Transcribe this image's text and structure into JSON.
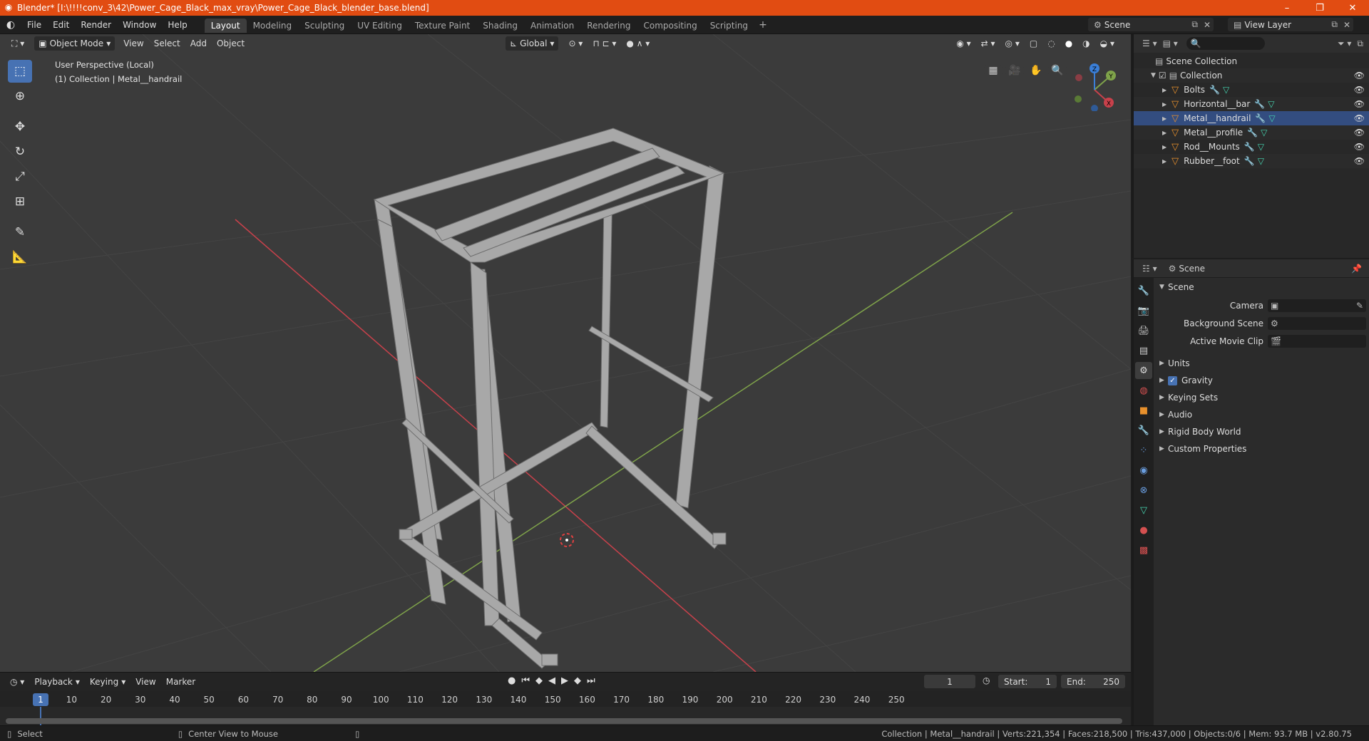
{
  "window": {
    "title": "Blender* [I:\\!!!!conv_3\\42\\Power_Cage_Black_max_vray\\Power_Cage_Black_blender_base.blend]",
    "controls": [
      "–",
      "❐",
      "✕"
    ]
  },
  "menu": [
    "File",
    "Edit",
    "Render",
    "Window",
    "Help"
  ],
  "workspaces": [
    "Layout",
    "Modeling",
    "Sculpting",
    "UV Editing",
    "Texture Paint",
    "Shading",
    "Animation",
    "Rendering",
    "Compositing",
    "Scripting"
  ],
  "active_workspace": "Layout",
  "scene_name": "Scene",
  "view_layer": "View Layer",
  "viewport": {
    "mode": "Object Mode",
    "menus": [
      "View",
      "Select",
      "Add",
      "Object"
    ],
    "orientation": "Global",
    "perspective_label": "User Perspective (Local)",
    "collection_label": "(1) Collection | Metal__handrail",
    "gizmo_axes": {
      "x": "X",
      "y": "Y",
      "z": "Z"
    }
  },
  "outliner": {
    "root": "Scene Collection",
    "collection": "Collection",
    "objects": [
      "Bolts",
      "Horizontal__bar",
      "Metal__handrail",
      "Metal__profile",
      "Rod__Mounts",
      "Rubber__foot"
    ],
    "selected": "Metal__handrail"
  },
  "properties": {
    "header": "Scene",
    "panel": "Scene",
    "fields": [
      {
        "label": "Camera",
        "value": ""
      },
      {
        "label": "Background Scene",
        "value": ""
      },
      {
        "label": "Active Movie Clip",
        "value": ""
      }
    ],
    "subpanels": [
      "Units",
      "Gravity",
      "Keying Sets",
      "Audio",
      "Rigid Body World",
      "Custom Properties"
    ],
    "gravity_checked": true
  },
  "timeline": {
    "menus": [
      "Playback",
      "Keying",
      "View",
      "Marker"
    ],
    "current_frame": "1",
    "start_label": "Start:",
    "start": "1",
    "end_label": "End:",
    "end": "250",
    "ticks": [
      "10",
      "20",
      "30",
      "40",
      "50",
      "60",
      "70",
      "80",
      "90",
      "100",
      "110",
      "120",
      "130",
      "140",
      "150",
      "160",
      "170",
      "180",
      "190",
      "200",
      "210",
      "220",
      "230",
      "240",
      "250"
    ]
  },
  "statusbar": {
    "left_action": "Select",
    "middle_action": "Center View to Mouse",
    "stats": "Collection | Metal__handrail | Verts:221,354 | Faces:218,500 | Tris:437,000 | Objects:0/6 | Mem: 93.7 MB | v2.80.75"
  },
  "colors": {
    "accent": "#4772b3",
    "titlebar": "#e14c12",
    "viewport_bg": "#3b3b3b",
    "x_axis": "#c8414b",
    "y_axis": "#7fa34a",
    "object_icon": "#e8902c"
  }
}
